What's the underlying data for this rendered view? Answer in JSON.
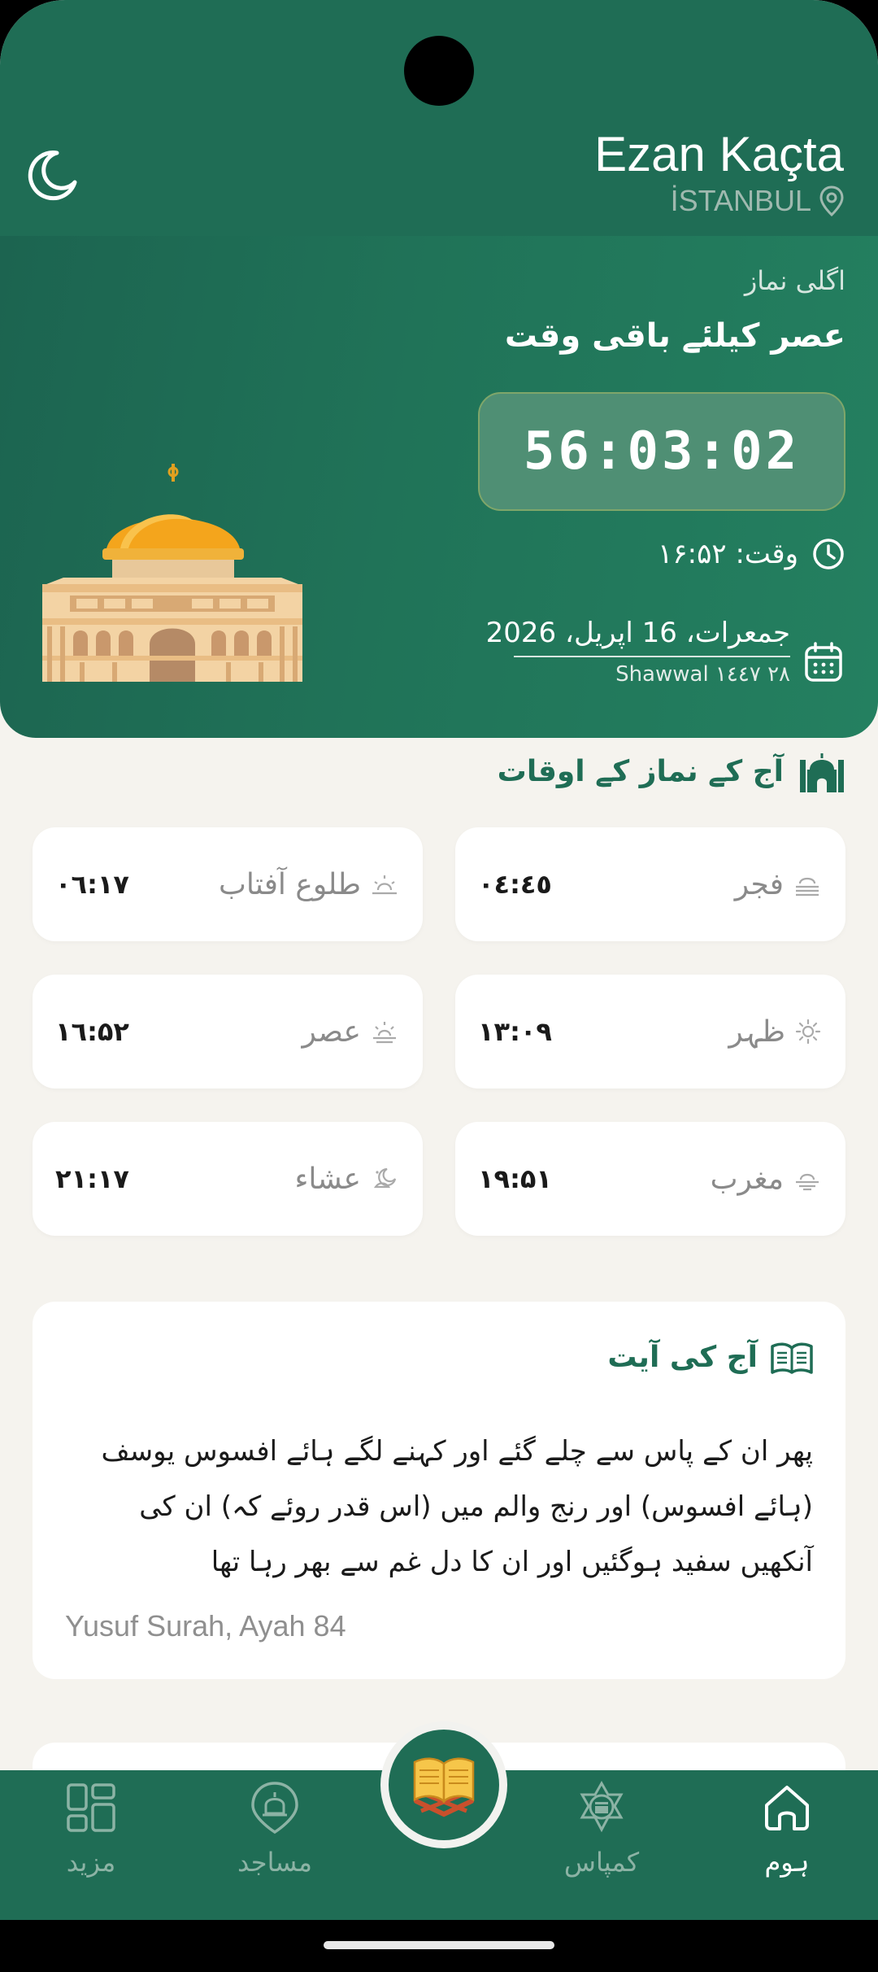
{
  "header": {
    "app_title": "Ezan Kaçta",
    "city": "İSTANBUL"
  },
  "next_prayer": {
    "label": "اگلی نماز",
    "remaining_title": "عصر کیلئے باقی وقت",
    "countdown": "56:03:02",
    "time_label": "وقت: ۱۶:۵۲",
    "date_gregorian": "جمعرات، 16 اپریل، 2026",
    "date_hijri": "۲۸ Shawwal ۱٤٤٧"
  },
  "today_prayers": {
    "title": "آج کے نماز کے اوقات",
    "items": [
      {
        "name": "فجر",
        "time": "۰٤:٤٥",
        "icon": "fajr-icon"
      },
      {
        "name": "طلوع آفتاب",
        "time": "۰٦:۱۷",
        "icon": "sunrise-icon"
      },
      {
        "name": "ظہر",
        "time": "۱۳:۰۹",
        "icon": "sun-icon"
      },
      {
        "name": "عصر",
        "time": "۱٦:۵۲",
        "icon": "asr-icon"
      },
      {
        "name": "مغرب",
        "time": "۱۹:۵۱",
        "icon": "maghrib-icon"
      },
      {
        "name": "عشاء",
        "time": "۲۱:۱۷",
        "icon": "isha-icon"
      }
    ]
  },
  "verse": {
    "title": "آج کی آیت",
    "text": "پھر ان کے پاس سے چلے گئے اور کہنے لگے ہائے افسوس یوسف (ہائے افسوس) اور رنج والم میں (اس قدر روئے کہ) ان کی آنکھیں سفید ہوگئیں اور ان کا دل غم سے بھر رہا تھا",
    "reference": "Yusuf Surah, Ayah 84"
  },
  "nav": {
    "more": "مزید",
    "mosques": "مساجد",
    "compass": "کمپاس",
    "home": "ہوم"
  },
  "colors": {
    "primary": "#1f6d55",
    "background": "#f5f3ee",
    "card": "#ffffff",
    "muted": "#8a8a8a"
  }
}
